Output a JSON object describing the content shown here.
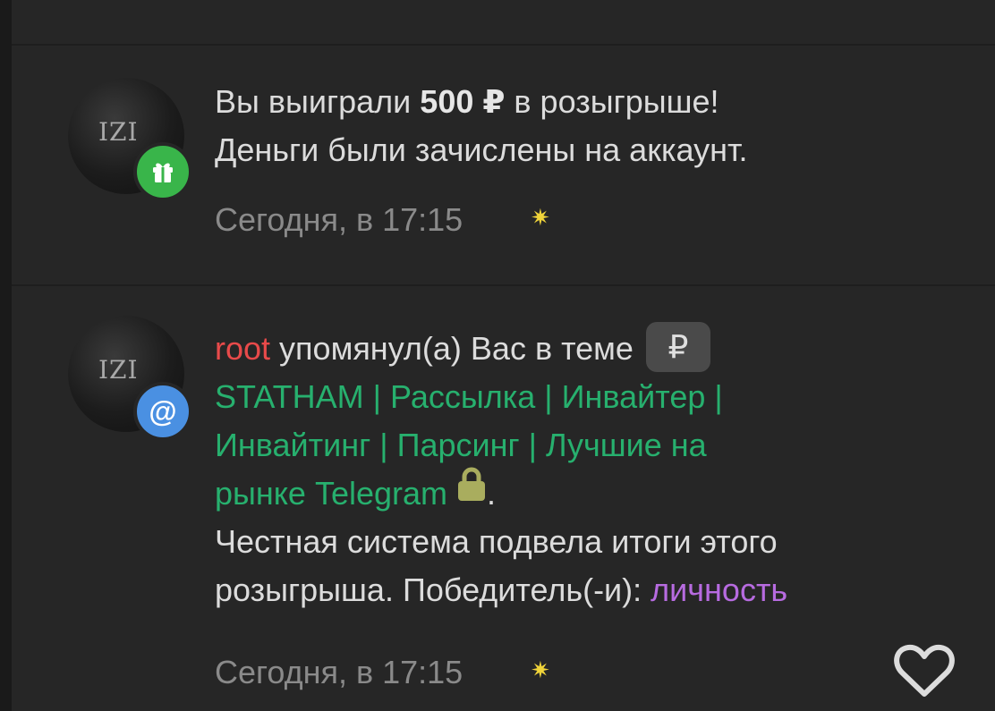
{
  "notifications": [
    {
      "avatar_mark": "IZI",
      "badge_icon": "gift-icon",
      "text_before": "Вы выиграли ",
      "amount": "500 ₽",
      "text_after": " в розыгрыше!",
      "line2": "Деньги были зачислены на аккаунт.",
      "time": "Сегодня, в 17:15"
    },
    {
      "avatar_mark": "IZI",
      "badge_icon": "at-icon",
      "badge_symbol": "@",
      "user": "root",
      "action": " упомянул(а) Вас в теме",
      "prefix_tag": "₽",
      "thread_line1": "STATHAM | Рассылка | Инвайтер |",
      "thread_line2": "Инвайтинг | Парсинг | Лучшие на",
      "thread_line3": "рынке Telegram",
      "after_lock": ".",
      "body_line1": "Честная система подвела итоги этого",
      "body_line2": "розыгрыша. Победитель(-и): ",
      "winner": "личность",
      "time": "Сегодня, в 17:15"
    }
  ],
  "colors": {
    "background": "#262626",
    "username": "#e84a4a",
    "thread_link": "#27b06e",
    "winner": "#b76be0",
    "gift_badge": "#39b54a",
    "mention_badge": "#4a90e2",
    "lock": "#a9ad5e"
  }
}
